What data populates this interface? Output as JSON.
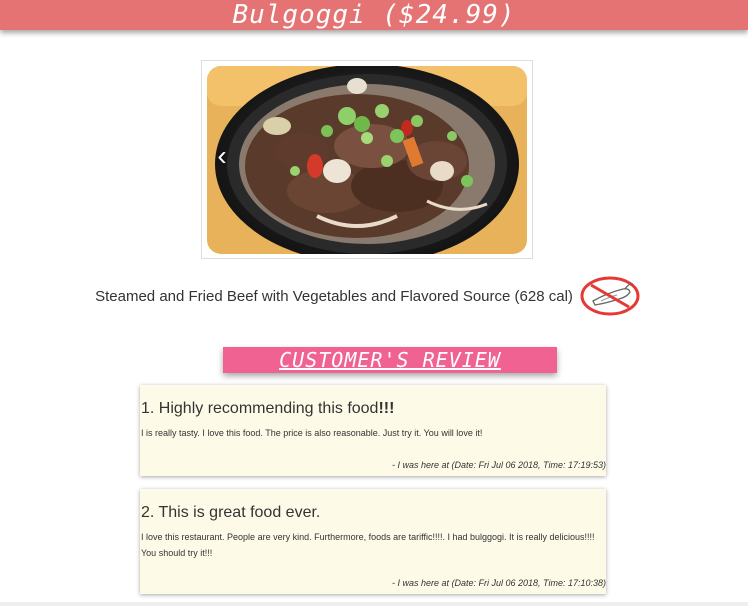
{
  "header": {
    "title": "Bulgoggi ($24.99)"
  },
  "carousel": {
    "prev_icon": "chevron-left-icon",
    "prev_glyph": "‹"
  },
  "dish": {
    "description": "Steamed and Fried Beef with Vegetables and Flavored Source (628 cal)",
    "badge_icon": "no-spicy-icon"
  },
  "reviews": {
    "heading": "CUSTOMER'S REVIEW",
    "items": [
      {
        "title": "1. Highly recommending this food",
        "title_emphasis": "!!!",
        "body": "I is really tasty. I love this food. The price is also reasonable. Just try it. You will love it!",
        "stamp": "- I was here at (Date: Fri Jul 06 2018, Time: 17:19:53)"
      },
      {
        "title": "2. This is great food ever.",
        "title_emphasis": "",
        "body": "I love this restaurant. People are very kind. Furthermore, foods are tariffic!!!!. I had bulggogi. It is really delicious!!!! You should try it!!!",
        "stamp": "- I was here at (Date: Fri Jul 06 2018, Time: 17:10:38)"
      }
    ]
  },
  "colors": {
    "header": "#e57373",
    "review_banner": "#f06292",
    "card": "#fdfbe8"
  }
}
